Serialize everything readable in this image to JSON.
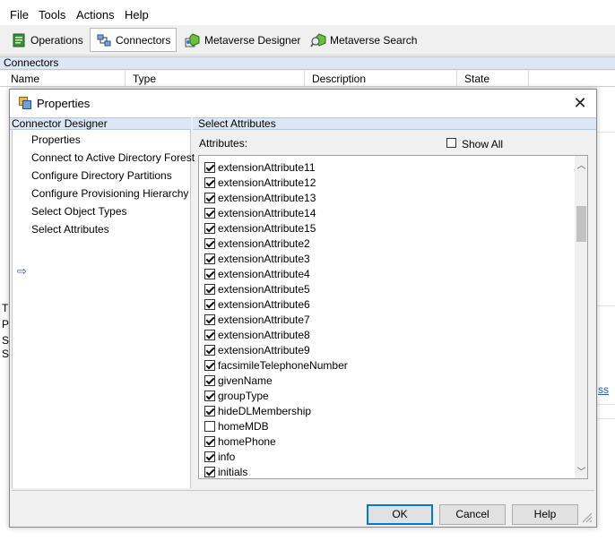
{
  "menu": [
    "File",
    "Tools",
    "Actions",
    "Help"
  ],
  "toolbar": [
    {
      "label": "Operations",
      "icon": "operations-icon"
    },
    {
      "label": "Connectors",
      "icon": "connectors-icon",
      "active": true
    },
    {
      "label": "Metaverse Designer",
      "icon": "metaverse-designer-icon"
    },
    {
      "label": "Metaverse Search",
      "icon": "metaverse-search-icon"
    }
  ],
  "connectors_panel": {
    "title": "Connectors",
    "columns": [
      "Name",
      "Type",
      "Description",
      "State"
    ]
  },
  "background_fragments": {
    "left_1": "T",
    "left_2": "P",
    "left_3": "S",
    "left_4": "S",
    "link_fragment": "ss"
  },
  "dialog": {
    "title": "Properties",
    "left_header": "Connector Designer",
    "nav": [
      {
        "label": "Properties",
        "selected": false
      },
      {
        "label": "Connect to Active Directory Forest",
        "selected": false
      },
      {
        "label": "Configure Directory Partitions",
        "selected": false
      },
      {
        "label": "Configure Provisioning Hierarchy",
        "selected": false
      },
      {
        "label": "Select Object Types",
        "selected": false
      },
      {
        "label": "Select Attributes",
        "selected": true
      }
    ],
    "right_header": "Select Attributes",
    "attributes_label": "Attributes:",
    "show_all_label": "Show All",
    "show_all_checked": false,
    "attributes": [
      {
        "name": "extensionAttribute11",
        "checked": true
      },
      {
        "name": "extensionAttribute12",
        "checked": true
      },
      {
        "name": "extensionAttribute13",
        "checked": true
      },
      {
        "name": "extensionAttribute14",
        "checked": true
      },
      {
        "name": "extensionAttribute15",
        "checked": true
      },
      {
        "name": "extensionAttribute2",
        "checked": true
      },
      {
        "name": "extensionAttribute3",
        "checked": true
      },
      {
        "name": "extensionAttribute4",
        "checked": true
      },
      {
        "name": "extensionAttribute5",
        "checked": true
      },
      {
        "name": "extensionAttribute6",
        "checked": true
      },
      {
        "name": "extensionAttribute7",
        "checked": true
      },
      {
        "name": "extensionAttribute8",
        "checked": true
      },
      {
        "name": "extensionAttribute9",
        "checked": true
      },
      {
        "name": "facsimileTelephoneNumber",
        "checked": true
      },
      {
        "name": "givenName",
        "checked": true
      },
      {
        "name": "groupType",
        "checked": true
      },
      {
        "name": "hideDLMembership",
        "checked": true
      },
      {
        "name": "homeMDB",
        "checked": false
      },
      {
        "name": "homePhone",
        "checked": true
      },
      {
        "name": "info",
        "checked": true
      },
      {
        "name": "initials",
        "checked": true
      }
    ],
    "buttons": {
      "ok": "OK",
      "cancel": "Cancel",
      "help": "Help"
    }
  }
}
